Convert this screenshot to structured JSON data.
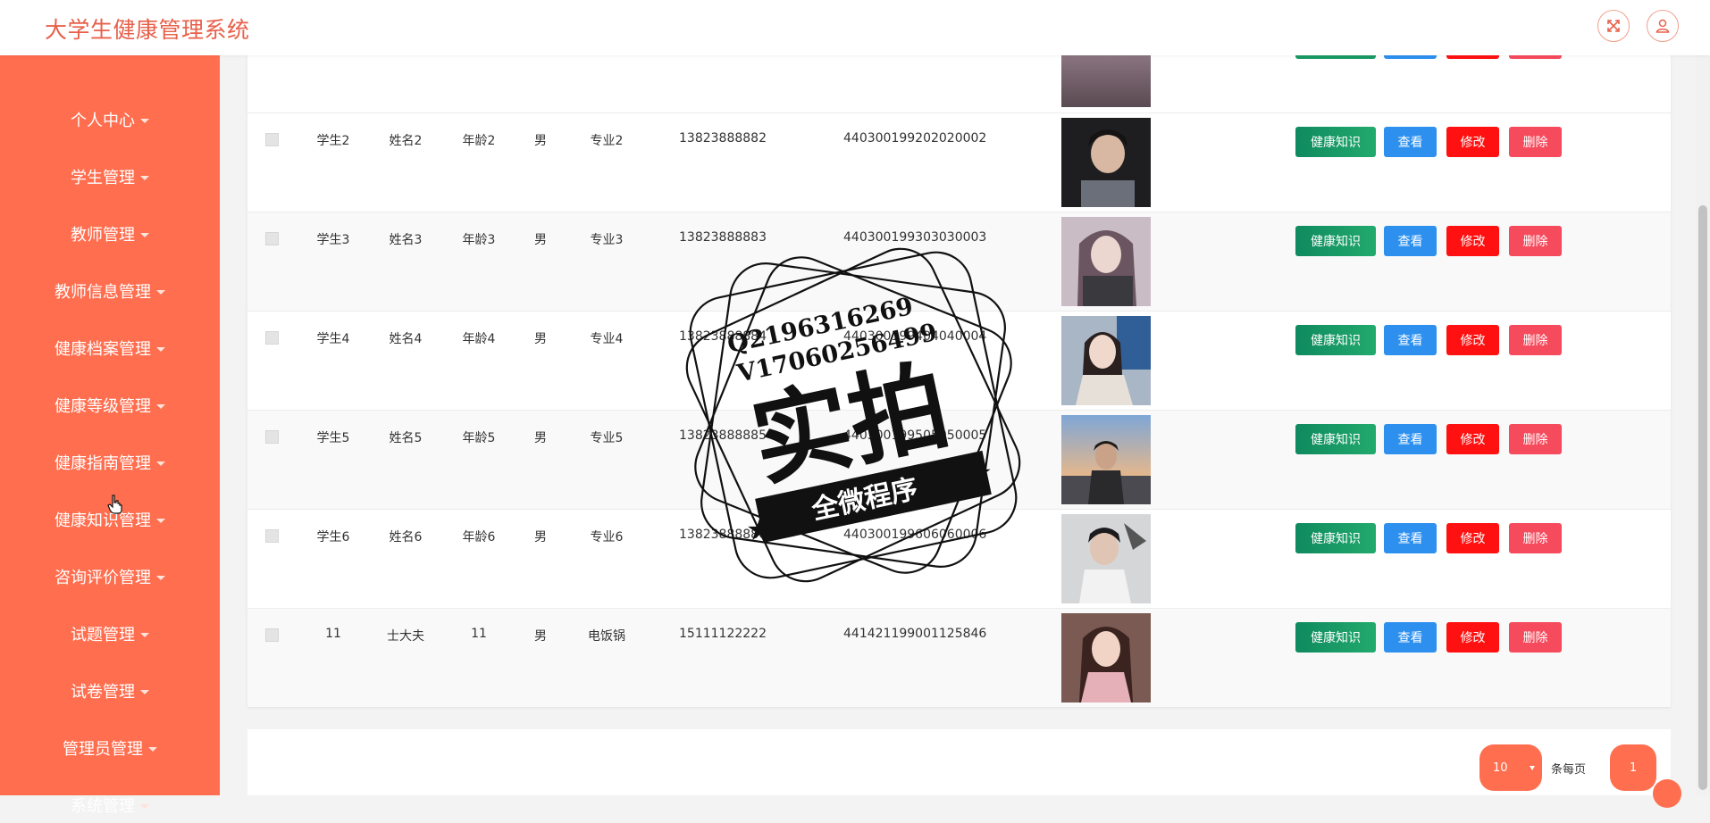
{
  "app": {
    "title": "大学生健康管理系统"
  },
  "header": {
    "fullscreen_icon": "expand-arrows-icon",
    "user_icon": "user-icon"
  },
  "sidebar": {
    "items": [
      {
        "label": "个人中心"
      },
      {
        "label": "学生管理"
      },
      {
        "label": "教师管理"
      },
      {
        "label": "教师信息管理"
      },
      {
        "label": "健康档案管理"
      },
      {
        "label": "健康等级管理"
      },
      {
        "label": "健康指南管理"
      },
      {
        "label": "健康知识管理"
      },
      {
        "label": "咨询评价管理"
      },
      {
        "label": "试题管理"
      },
      {
        "label": "试卷管理"
      },
      {
        "label": "管理员管理"
      },
      {
        "label": "系统管理"
      }
    ]
  },
  "table": {
    "actions": {
      "knowledge": "健康知识",
      "view": "查看",
      "edit": "修改",
      "delete": "删除"
    },
    "rows": [
      {
        "student_no": "学生2",
        "name": "姓名2",
        "age": "年龄2",
        "gender": "男",
        "major": "专业2",
        "phone": "13823888882",
        "id_number": "440300199202020002",
        "photo": "photo-boy-dark-hair"
      },
      {
        "student_no": "学生3",
        "name": "姓名3",
        "age": "年龄3",
        "gender": "男",
        "major": "专业3",
        "phone": "13823888883",
        "id_number": "440300199303030003",
        "photo": "photo-girl-scarf"
      },
      {
        "student_no": "学生4",
        "name": "姓名4",
        "age": "年龄4",
        "gender": "男",
        "major": "专业4",
        "phone": "13823888884",
        "id_number": "440300199404040004",
        "photo": "photo-girl-white-coat"
      },
      {
        "student_no": "学生5",
        "name": "姓名5",
        "age": "年龄5",
        "gender": "男",
        "major": "专业5",
        "phone": "13823888885",
        "id_number": "440300199505050005",
        "photo": "photo-boy-sunset"
      },
      {
        "student_no": "学生6",
        "name": "姓名6",
        "age": "年龄6",
        "gender": "男",
        "major": "专业6",
        "phone": "13823888886",
        "id_number": "440300199606060006",
        "photo": "photo-boy-white-shirt"
      },
      {
        "student_no": "11",
        "name": "士大夫",
        "age": "11",
        "gender": "男",
        "major": "电饭锅",
        "phone": "15111122222",
        "id_number": "441421199001125846",
        "photo": "photo-girl-pink"
      }
    ]
  },
  "pagination": {
    "page_size": "10",
    "per_page_label": "条每页",
    "current_page": "1"
  },
  "watermark": {
    "line1": "Q2196316269",
    "line2": "V17060256499",
    "big_text": "实拍",
    "banner": "全微程序"
  },
  "colors": {
    "sidebar": "#ff6e4f",
    "title": "#e8604a",
    "knowledge": "#1a9a65",
    "view": "#2d90ef",
    "edit": "#ff1111",
    "delete": "#f54b5d"
  }
}
